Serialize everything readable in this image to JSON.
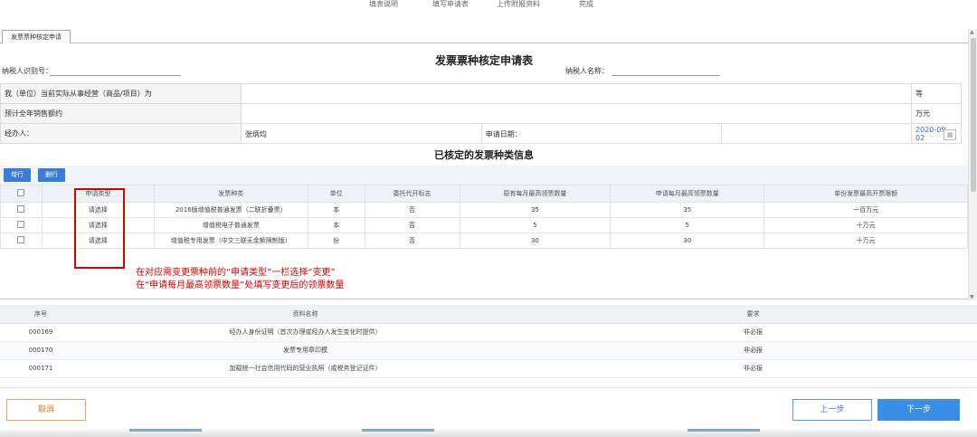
{
  "steps": [
    "填表说明",
    "填写申请表",
    "上传附报资料",
    "完成"
  ],
  "tab": {
    "label": "发票票种核定申请"
  },
  "form": {
    "title": "发票票种核定申请表",
    "taxpayer_id_label": "纳税人识别号：",
    "taxpayer_name_label": "纳税人名称：",
    "row1_label": "我（单位）当前实际从事经营（商品/项目）为",
    "row1_suffix": "等",
    "row2_label": "预计全年销售额约",
    "row2_suffix": "万元",
    "agent_label": "经办人：",
    "agent_value": "张炳均",
    "date_label": "申请日期：",
    "date_value": "2020-09-02"
  },
  "section_title": "已核定的发票种类信息",
  "toolbar": {
    "add_label": "增行",
    "delete_label": "删行"
  },
  "grid": {
    "columns": [
      "申请类型",
      "发票种类",
      "单位",
      "委托代开标志",
      "原有每月最高领票数量",
      "申请每月最高领票数量",
      "单份发票最高开票限额"
    ],
    "rows": [
      {
        "type": "请选择",
        "kind": "2016版增值税普通发票（二联折叠票）",
        "unit": "本",
        "flag": "否",
        "orig": "35",
        "apply": "35",
        "limit": "一百万元"
      },
      {
        "type": "请选择",
        "kind": "增值税电子普通发票",
        "unit": "本",
        "flag": "否",
        "orig": "5",
        "apply": "5",
        "limit": "十万元"
      },
      {
        "type": "请选择",
        "kind": "增值税专用发票（中文三联无金额限制版）",
        "unit": "份",
        "flag": "否",
        "orig": "30",
        "apply": "30",
        "limit": "十万元"
      }
    ]
  },
  "annotation": {
    "line1": "在对应需变更票种前的“申请类型”一栏选择“变更”",
    "line2": "在“申请每月最高领票数量”处填写变更后的领票数量"
  },
  "materials": {
    "columns": [
      "序号",
      "资料名称",
      "要求"
    ],
    "rows": [
      {
        "no": "000169",
        "name": "经办人身份证明（首次办理或经办人发生变化时提供）",
        "req": "非必报"
      },
      {
        "no": "000170",
        "name": "发票专用章印模",
        "req": "非必报"
      },
      {
        "no": "000171",
        "name": "加载统一社会信用代码的营业执照（或税务登记证件）",
        "req": "非必报"
      }
    ]
  },
  "footer": {
    "cancel_label": "取消",
    "prev_label": "上一步",
    "next_label": "下一步"
  },
  "colors": {
    "accent": "#3a7bd5",
    "annotation_red": "#d90000",
    "cancel_orange": "#e07a20"
  }
}
